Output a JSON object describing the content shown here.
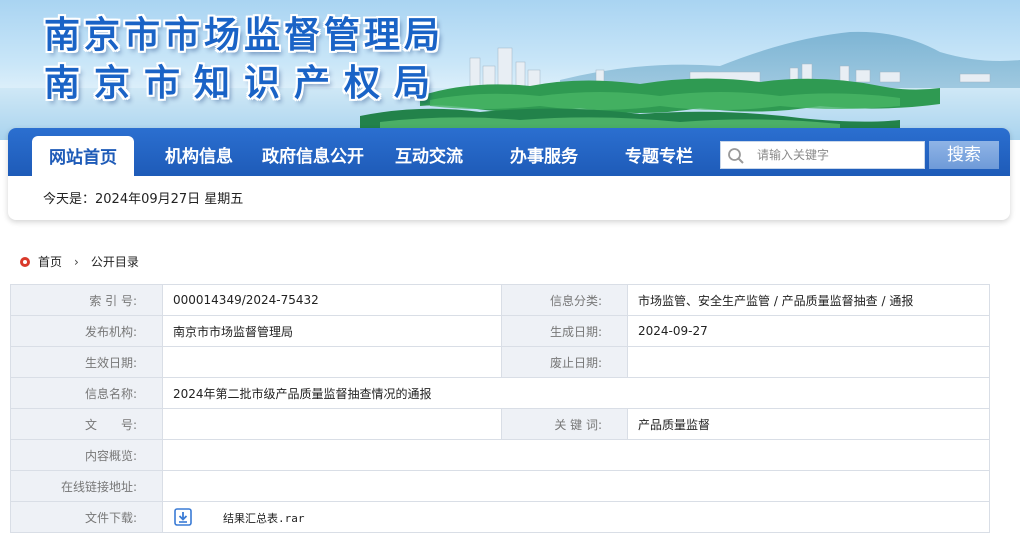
{
  "header": {
    "title_line1": "南京市市场监督管理局",
    "title_line2": "南京市知识产权局"
  },
  "nav": {
    "items": [
      "网站首页",
      "机构信息",
      "政府信息公开",
      "互动交流",
      "办事服务",
      "专题专栏"
    ],
    "active_index": 0,
    "search_placeholder": "请输入关键字",
    "search_button": "搜索"
  },
  "today": "今天是：2024年09月27日 星期五",
  "breadcrumb": {
    "home": "首页",
    "current": "公开目录"
  },
  "info": {
    "index_no_label": "索 引 号:",
    "index_no": "000014349/2024-75432",
    "category_label": "信息分类:",
    "category": "市场监管、安全生产监管 / 产品质量监督抽查 / 通报",
    "publisher_label": "发布机构:",
    "publisher": "南京市市场监督管理局",
    "created_label": "生成日期:",
    "created": "2024-09-27",
    "effective_label": "生效日期:",
    "effective": "",
    "expired_label": "废止日期:",
    "expired": "",
    "name_label": "信息名称:",
    "name": "2024年第二批市级产品质量监督抽查情况的通报",
    "doc_no_label": "文　　号:",
    "doc_no": "",
    "keywords_label": "关 键 词:",
    "keywords": "产品质量监督",
    "summary_label": "内容概览:",
    "summary": "",
    "link_label": "在线链接地址:",
    "link": "",
    "download_label": "文件下载:",
    "download_file": "结果汇总表.rar"
  },
  "colors": {
    "nav_blue": "#1e5bb8",
    "title_blue": "#1a63c6",
    "label_bg": "#eef1f6",
    "breadcrumb_dot": "#d93a2b"
  }
}
